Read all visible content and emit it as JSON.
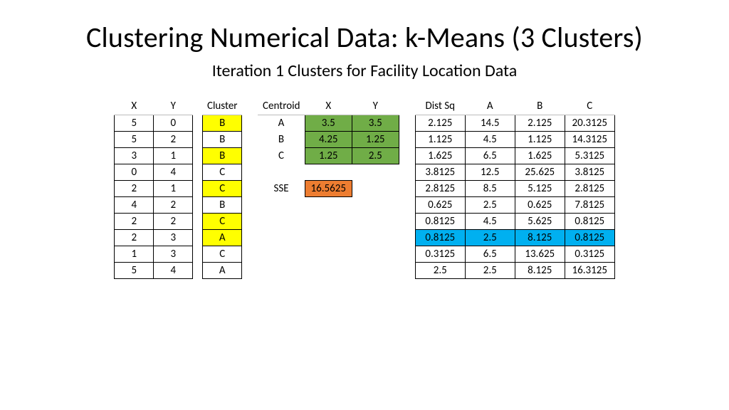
{
  "title": "Clustering Numerical Data: k-Means (3 Clusters)",
  "subtitle": "Iteration 1 Clusters for Facility Location Data",
  "left": {
    "headers": {
      "x": "X",
      "y": "Y",
      "cluster": "Cluster"
    },
    "rows": [
      {
        "x": 5,
        "y": 0,
        "cluster": "B",
        "hl": true
      },
      {
        "x": 5,
        "y": 2,
        "cluster": "B",
        "hl": false
      },
      {
        "x": 3,
        "y": 1,
        "cluster": "B",
        "hl": true
      },
      {
        "x": 0,
        "y": 4,
        "cluster": "C",
        "hl": false
      },
      {
        "x": 2,
        "y": 1,
        "cluster": "C",
        "hl": true
      },
      {
        "x": 4,
        "y": 2,
        "cluster": "B",
        "hl": false
      },
      {
        "x": 2,
        "y": 2,
        "cluster": "C",
        "hl": true
      },
      {
        "x": 2,
        "y": 3,
        "cluster": "A",
        "hl": true
      },
      {
        "x": 1,
        "y": 3,
        "cluster": "C",
        "hl": false
      },
      {
        "x": 5,
        "y": 4,
        "cluster": "A",
        "hl": false
      }
    ]
  },
  "center": {
    "headers": {
      "centroid": "Centroid",
      "x": "X",
      "y": "Y"
    },
    "rows": [
      {
        "label": "A",
        "x": "3.5",
        "y": "3.5"
      },
      {
        "label": "B",
        "x": "4.25",
        "y": "1.25"
      },
      {
        "label": "C",
        "x": "1.25",
        "y": "2.5"
      }
    ],
    "sse_label": "SSE",
    "sse_value": "16.5625"
  },
  "right": {
    "headers": {
      "dsq": "Dist Sq",
      "a": "A",
      "b": "B",
      "c": "C"
    },
    "rows": [
      {
        "dsq": "2.125",
        "a": "14.5",
        "b": "2.125",
        "c": "20.3125",
        "blue": false
      },
      {
        "dsq": "1.125",
        "a": "4.5",
        "b": "1.125",
        "c": "14.3125",
        "blue": false
      },
      {
        "dsq": "1.625",
        "a": "6.5",
        "b": "1.625",
        "c": "5.3125",
        "blue": false
      },
      {
        "dsq": "3.8125",
        "a": "12.5",
        "b": "25.625",
        "c": "3.8125",
        "blue": false
      },
      {
        "dsq": "2.8125",
        "a": "8.5",
        "b": "5.125",
        "c": "2.8125",
        "blue": false
      },
      {
        "dsq": "0.625",
        "a": "2.5",
        "b": "0.625",
        "c": "7.8125",
        "blue": false
      },
      {
        "dsq": "0.8125",
        "a": "4.5",
        "b": "5.625",
        "c": "0.8125",
        "blue": false
      },
      {
        "dsq": "0.8125",
        "a": "2.5",
        "b": "8.125",
        "c": "0.8125",
        "blue": true
      },
      {
        "dsq": "0.3125",
        "a": "6.5",
        "b": "13.625",
        "c": "0.3125",
        "blue": false
      },
      {
        "dsq": "2.5",
        "a": "2.5",
        "b": "8.125",
        "c": "16.3125",
        "blue": false
      }
    ]
  },
  "chart_data": {
    "type": "table",
    "title": "Iteration 1 Clusters for Facility Location Data",
    "points": [
      {
        "x": 5,
        "y": 0,
        "cluster": "B"
      },
      {
        "x": 5,
        "y": 2,
        "cluster": "B"
      },
      {
        "x": 3,
        "y": 1,
        "cluster": "B"
      },
      {
        "x": 0,
        "y": 4,
        "cluster": "C"
      },
      {
        "x": 2,
        "y": 1,
        "cluster": "C"
      },
      {
        "x": 4,
        "y": 2,
        "cluster": "B"
      },
      {
        "x": 2,
        "y": 2,
        "cluster": "C"
      },
      {
        "x": 2,
        "y": 3,
        "cluster": "A"
      },
      {
        "x": 1,
        "y": 3,
        "cluster": "C"
      },
      {
        "x": 5,
        "y": 4,
        "cluster": "A"
      }
    ],
    "centroids": {
      "A": [
        3.5,
        3.5
      ],
      "B": [
        4.25,
        1.25
      ],
      "C": [
        1.25,
        2.5
      ]
    },
    "sse": 16.5625,
    "distances_sq": [
      {
        "min": 2.125,
        "A": 14.5,
        "B": 2.125,
        "C": 20.3125
      },
      {
        "min": 1.125,
        "A": 4.5,
        "B": 1.125,
        "C": 14.3125
      },
      {
        "min": 1.625,
        "A": 6.5,
        "B": 1.625,
        "C": 5.3125
      },
      {
        "min": 3.8125,
        "A": 12.5,
        "B": 25.625,
        "C": 3.8125
      },
      {
        "min": 2.8125,
        "A": 8.5,
        "B": 5.125,
        "C": 2.8125
      },
      {
        "min": 0.625,
        "A": 2.5,
        "B": 0.625,
        "C": 7.8125
      },
      {
        "min": 0.8125,
        "A": 4.5,
        "B": 5.625,
        "C": 0.8125
      },
      {
        "min": 0.8125,
        "A": 2.5,
        "B": 8.125,
        "C": 0.8125
      },
      {
        "min": 0.3125,
        "A": 6.5,
        "B": 13.625,
        "C": 0.3125
      },
      {
        "min": 2.5,
        "A": 2.5,
        "B": 8.125,
        "C": 16.3125
      }
    ]
  }
}
